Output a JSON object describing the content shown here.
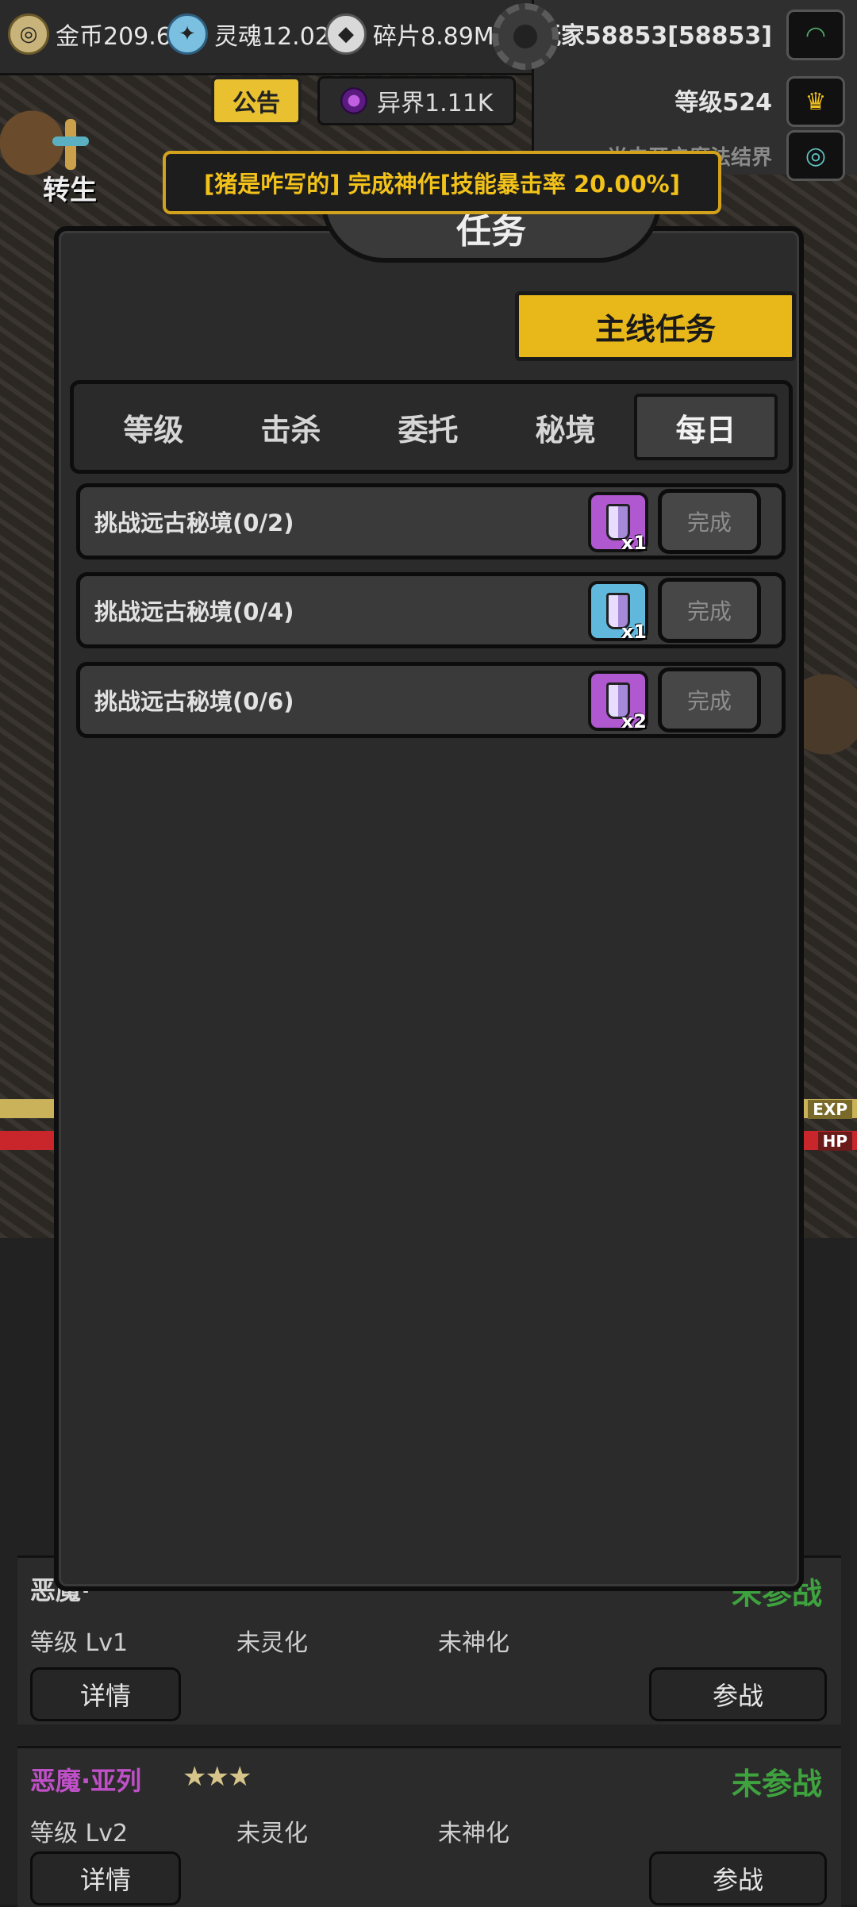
{
  "hud": {
    "gold": "金币209.6",
    "soul": "灵魂12.02",
    "shards": "碎片8.89M",
    "player_name": "玩家58853[58853]",
    "player_level": "等级524",
    "hidden_text": "当未开启魔法结界",
    "announce_label": "公告",
    "realm": "异界1.11K",
    "rebirth_label": "转生"
  },
  "notice": "[猪是咋写的] 完成神作[技能暴击率 20.00%]",
  "panel": {
    "title": "任务",
    "main_quest_label": "主线任务",
    "tabs": [
      "等级",
      "击杀",
      "委托",
      "秘境",
      "每日"
    ],
    "active_tab": "每日",
    "tasks": [
      {
        "name": "挑战远古秘境(0/2)",
        "reward_qty": "x1",
        "reward_color": "purple",
        "button": "完成"
      },
      {
        "name": "挑战远古秘境(0/4)",
        "reward_qty": "x1",
        "reward_color": "blue",
        "button": "完成"
      },
      {
        "name": "挑战远古秘境(0/6)",
        "reward_qty": "x2",
        "reward_color": "purple",
        "button": "完成"
      }
    ]
  },
  "scene": {
    "exp_tag": "EXP",
    "hp_tag": "HP"
  },
  "cards": [
    {
      "name": "恶魔·亚列",
      "stars": "★★★",
      "status": "未参战",
      "level": "等级 Lv2",
      "spirit": "未灵化",
      "god": "未神化",
      "detail": "详情",
      "join": "参战"
    },
    {
      "name": "恶魔·",
      "stars": "",
      "status": "未参战",
      "level": "等级 Lv1",
      "spirit": "未灵化",
      "god": "未神化",
      "detail": "详情",
      "join": "参战"
    }
  ],
  "colors": {
    "accent": "#e8b81a",
    "notice_text": "#f2c21a",
    "status_green": "#3ea33e",
    "card_name": "#c050c8"
  }
}
